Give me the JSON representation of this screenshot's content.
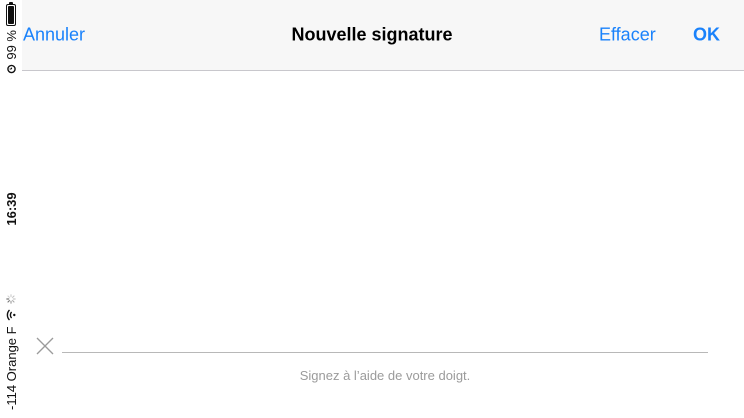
{
  "status_bar": {
    "carrier": "-114 Orange F",
    "time": "16:39",
    "battery_text": "99 %",
    "battery_level": 0.99,
    "icons": [
      "wifi-icon",
      "loading-spinner-icon",
      "alarm-icon",
      "battery-icon"
    ]
  },
  "nav": {
    "cancel_label": "Annuler",
    "title": "Nouvelle signature",
    "clear_label": "Effacer",
    "ok_label": "OK"
  },
  "signature": {
    "hint": "Signez à l’aide de votre doigt.",
    "marker_icon": "x-mark-icon"
  },
  "colors": {
    "accent": "#1a82fb",
    "nav_background": "#f7f7f7",
    "hint_text": "#9b9b9b"
  }
}
